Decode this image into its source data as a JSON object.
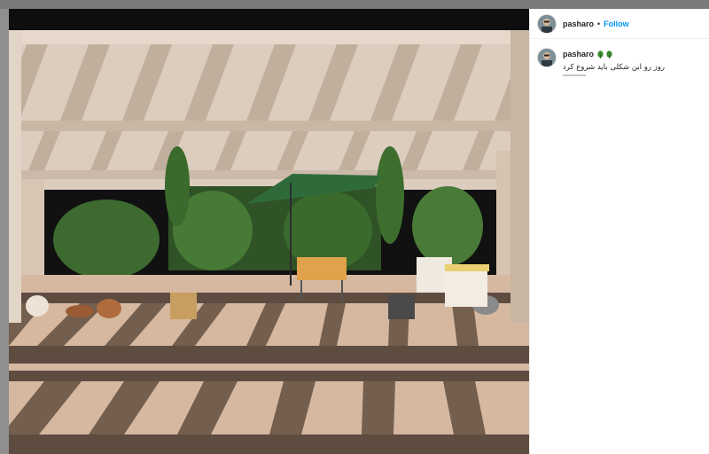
{
  "post": {
    "image": {
      "description": "sunlit rooftop terrace with pergola shadows and potted plants",
      "sky_color": "#111111",
      "wall_color": "#d9cbbd",
      "floor_color": "#d4b49c",
      "shadow_color": "#5a4a3e",
      "plant_color": "#3f6b2e",
      "umbrella_color": "#2f6b3a",
      "tablecloth_color": "#e0a24a"
    }
  },
  "header": {
    "username": "pasharo",
    "separator": "•",
    "follow_label": "Follow"
  },
  "caption": {
    "username": "pasharo",
    "leaf_icons": [
      "leaf-icon",
      "leaf-icon"
    ],
    "text": "روز رو این شکلی باید شروع کرد"
  },
  "colors": {
    "accent": "#0095f6",
    "text": "#262626",
    "panel_bg": "#ffffff"
  }
}
